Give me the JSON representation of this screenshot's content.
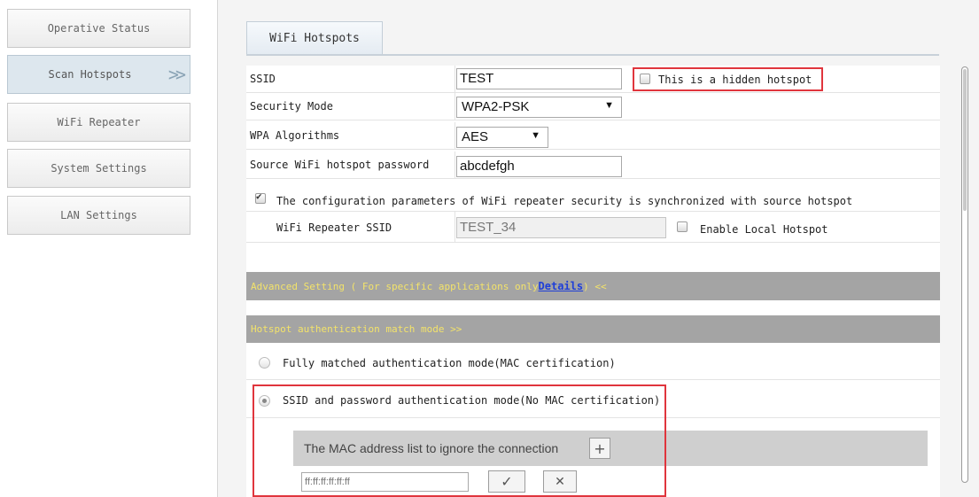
{
  "sidebar": {
    "items": [
      {
        "label": "Operative Status"
      },
      {
        "label": "Scan Hotspots",
        "arrow": ">>"
      },
      {
        "label": "WiFi Repeater"
      },
      {
        "label": "System Settings"
      },
      {
        "label": "LAN Settings"
      }
    ]
  },
  "tab": {
    "label": "WiFi Hotspots"
  },
  "form": {
    "ssid": {
      "label": "SSID",
      "value": "TEST",
      "hidden_label": "This is a hidden hotspot",
      "hidden_checked": false
    },
    "security": {
      "label": "Security Mode",
      "value": "WPA2-PSK"
    },
    "wpa": {
      "label": "WPA Algorithms",
      "value": "AES"
    },
    "password": {
      "label": "Source WiFi hotspot password",
      "value": "abcdefgh"
    },
    "sync": {
      "label": "The configuration parameters of WiFi repeater security is synchronized with source hotspot",
      "checked": true
    },
    "repeater": {
      "label": "WiFi Repeater SSID",
      "value": "TEST_34",
      "local_label": "Enable Local Hotspot",
      "local_checked": false
    }
  },
  "advanced": {
    "prefix": "Advanced Setting ( For specific applications only ",
    "link": "Details",
    "suffix": " ) <<"
  },
  "auth": {
    "header": "Hotspot authentication match mode >>",
    "options": [
      {
        "label": "Fully matched authentication mode(MAC certification)",
        "selected": false
      },
      {
        "label": "SSID and password authentication mode(No MAC certification)",
        "selected": true
      }
    ]
  },
  "maclist": {
    "title": "The MAC address list to ignore the connection",
    "add": "+",
    "placeholder": "ff:ff:ff:ff:ff:ff",
    "confirm": "✓",
    "cancel": "✕"
  },
  "colors": {
    "highlight": "#e0353d",
    "bar": "#a4a4a4",
    "bar_text": "#f3e36a",
    "link": "#1f3fd8"
  }
}
